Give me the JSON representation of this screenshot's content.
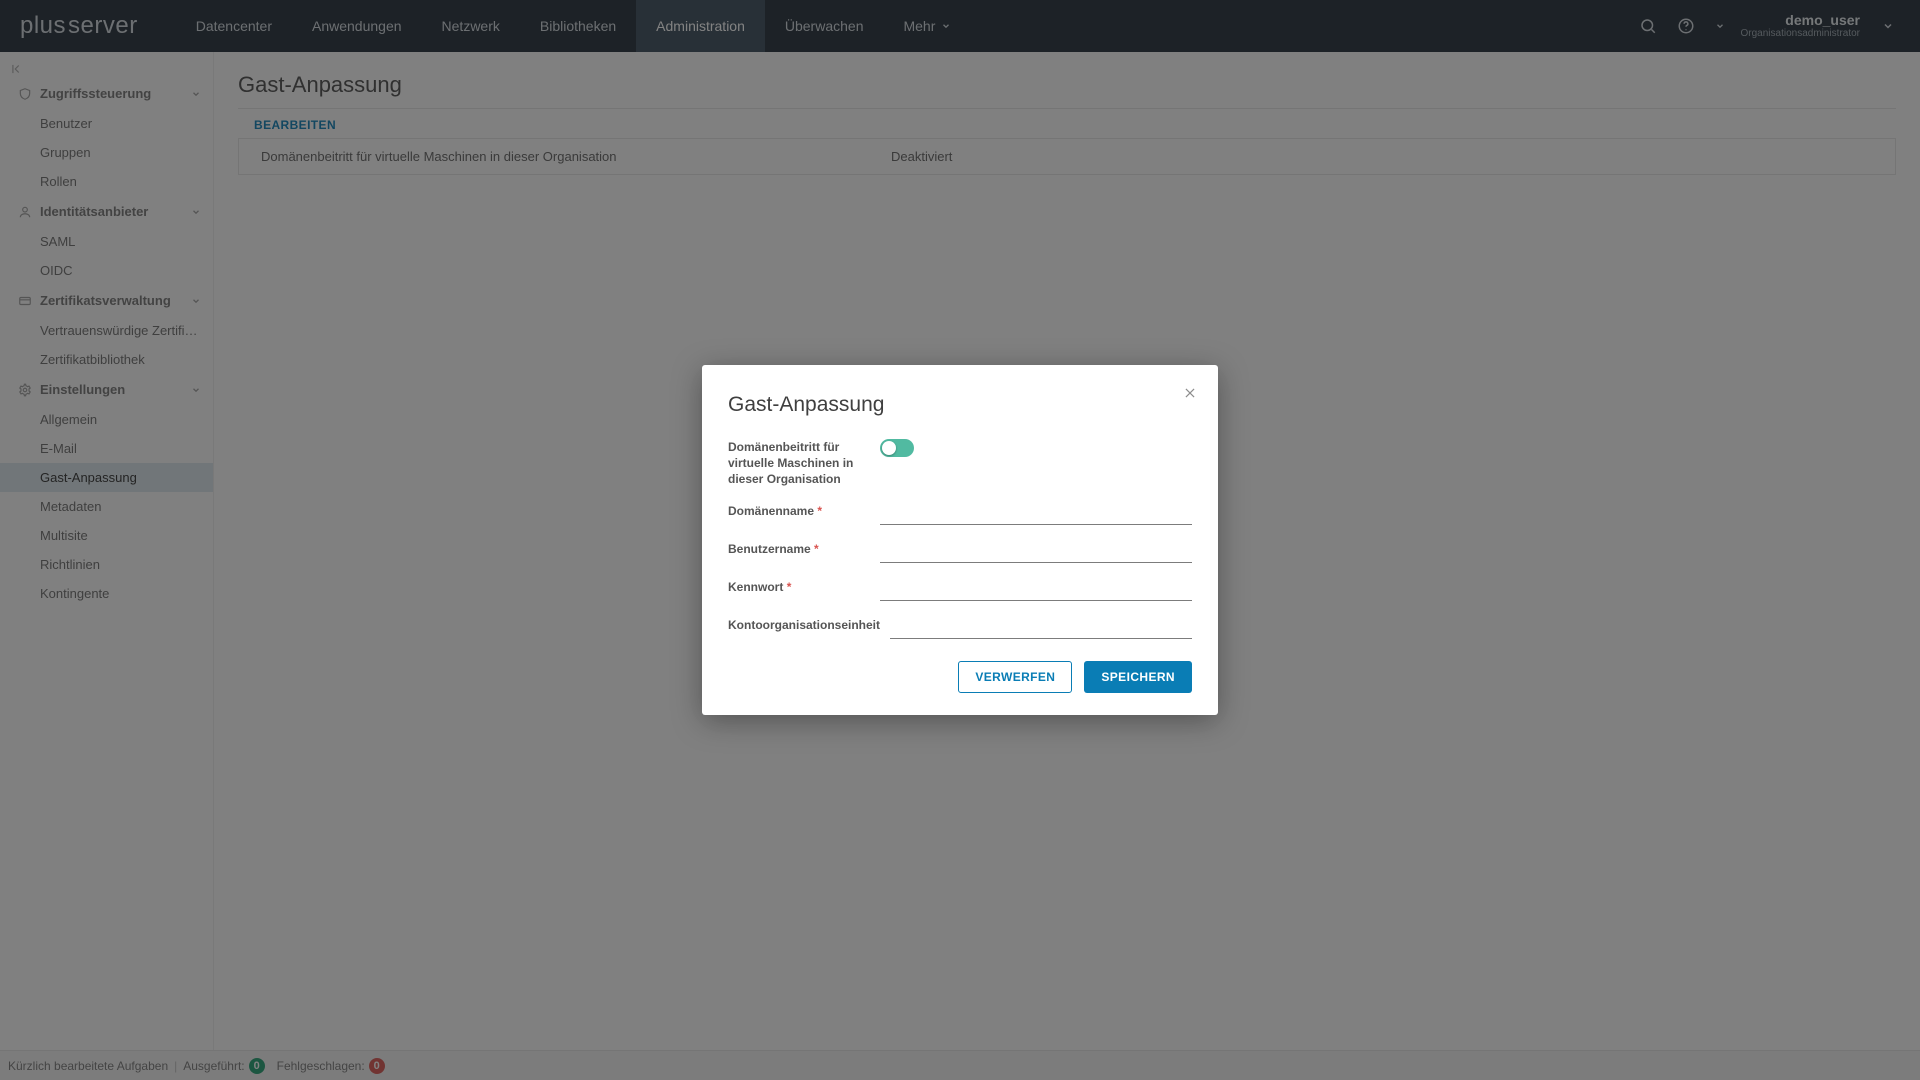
{
  "brand": {
    "word1": "plus",
    "word2": "server"
  },
  "topnav": {
    "items": [
      {
        "label": "Datencenter",
        "active": false
      },
      {
        "label": "Anwendungen",
        "active": false
      },
      {
        "label": "Netzwerk",
        "active": false
      },
      {
        "label": "Bibliotheken",
        "active": false
      },
      {
        "label": "Administration",
        "active": true
      },
      {
        "label": "Überwachen",
        "active": false
      },
      {
        "label": "Mehr",
        "active": false,
        "caret": true
      }
    ],
    "user": {
      "name": "demo_user",
      "role": "Organisationsadministrator"
    }
  },
  "sidebar": {
    "groups": [
      {
        "icon": "shield",
        "label": "Zugriffssteuerung",
        "items": [
          {
            "label": "Benutzer",
            "active": false
          },
          {
            "label": "Gruppen",
            "active": false
          },
          {
            "label": "Rollen",
            "active": false
          }
        ]
      },
      {
        "icon": "user",
        "label": "Identitätsanbieter",
        "items": [
          {
            "label": "SAML",
            "active": false
          },
          {
            "label": "OIDC",
            "active": false
          }
        ]
      },
      {
        "icon": "card",
        "label": "Zertifikatsverwaltung",
        "items": [
          {
            "label": "Vertrauenswürdige Zertifi…",
            "active": false
          },
          {
            "label": "Zertifikatbibliothek",
            "active": false
          }
        ]
      },
      {
        "icon": "gear",
        "label": "Einstellungen",
        "items": [
          {
            "label": "Allgemein",
            "active": false
          },
          {
            "label": "E-Mail",
            "active": false
          },
          {
            "label": "Gast-Anpassung",
            "active": true
          },
          {
            "label": "Metadaten",
            "active": false
          },
          {
            "label": "Multisite",
            "active": false
          },
          {
            "label": "Richtlinien",
            "active": false
          },
          {
            "label": "Kontingente",
            "active": false
          }
        ]
      }
    ]
  },
  "page": {
    "title": "Gast-Anpassung",
    "edit_label": "BEARBEITEN",
    "row_key": "Domänenbeitritt für virtuelle Maschinen in dieser Organisation",
    "row_value": "Deaktiviert"
  },
  "footer": {
    "recent": "Kürzlich bearbeitete Aufgaben",
    "done_label": "Ausgeführt:",
    "done_count": "0",
    "fail_label": "Fehlgeschlagen:",
    "fail_count": "0"
  },
  "modal": {
    "title": "Gast-Anpassung",
    "toggle_label": "Domänenbeitritt für virtuelle Maschinen in dieser Organisation",
    "toggle_on": true,
    "fields": {
      "domain_label": "Domänenname",
      "user_label": "Benutzername",
      "pw_label": "Kennwort",
      "ou_label": "Kontoorganisationseinheit",
      "domain_value": "",
      "user_value": "",
      "pw_value": "",
      "ou_value": ""
    },
    "discard": "VERWERFEN",
    "save": "SPEICHERN"
  }
}
